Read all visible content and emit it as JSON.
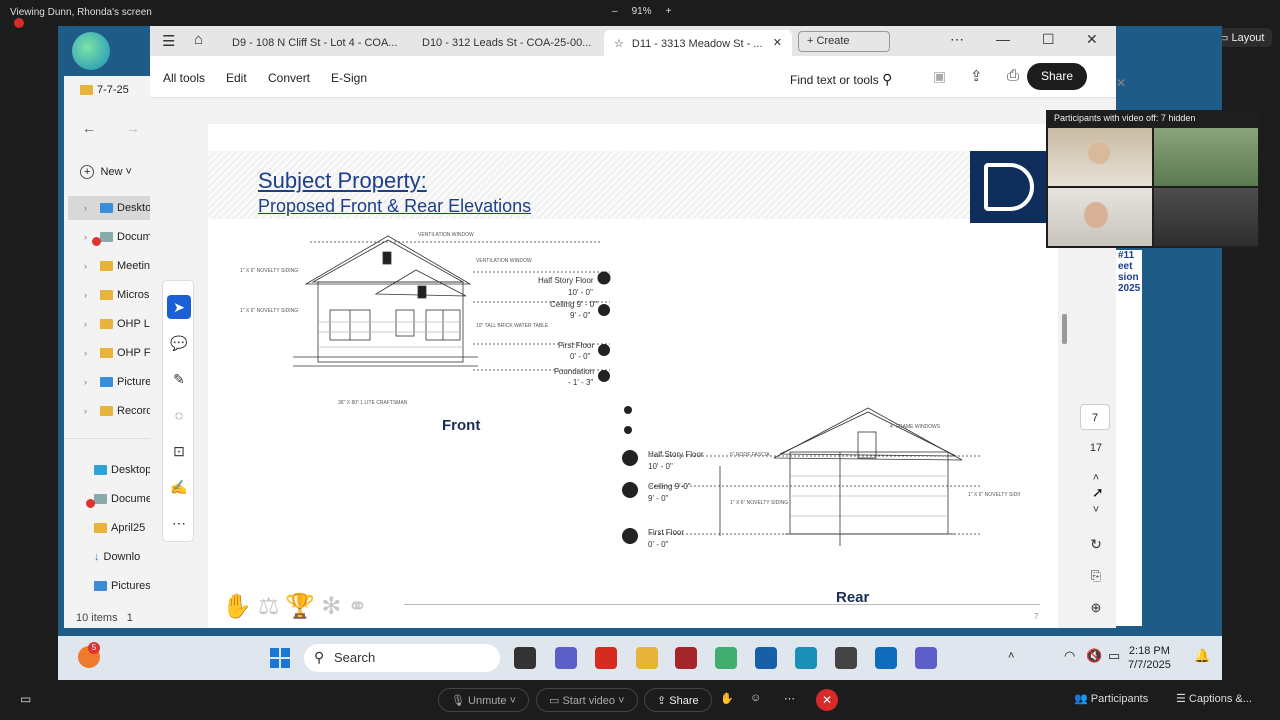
{
  "zoom": {
    "viewing_label": "Viewing Dunn, Rhonda's screen",
    "zoom_minus": "–",
    "zoom_level": "91%",
    "zoom_plus": "+",
    "layout_label": "Layout",
    "participants_overlay_title": "Participants with video off: 7 hidden",
    "bottom": {
      "unmute": "Unmute",
      "start_video": "Start video",
      "share": "Share",
      "participants": "Participants",
      "captions": "Captions &..."
    }
  },
  "explorer": {
    "title": "7-7-25",
    "new_label": "New",
    "items": [
      "Deskto",
      "Docum",
      "Meetin",
      "Micros",
      "OHP L",
      "OHP F",
      "Picture",
      "Record"
    ],
    "quick": [
      "Desktop",
      "Docume",
      "April25",
      "Downlo",
      "Pictures"
    ],
    "status": "10 items",
    "status_sel": "1"
  },
  "browser": {
    "tabs": [
      "D9 - 108 N Cliff St - Lot 4 - COA...",
      "D10 - 312 Leads St - COA-25-00...",
      "D11 - 3313 Meadow St - ..."
    ],
    "create_label": "Create",
    "toolbar": {
      "all_tools": "All tools",
      "edit": "Edit",
      "convert": "Convert",
      "esign": "E-Sign",
      "find": "Find text or tools",
      "share": "Share"
    }
  },
  "slide": {
    "title": "Subject Property:",
    "subtitle": "Proposed Front & Rear Elevations",
    "front_caption": "Front",
    "rear_caption": "Rear",
    "page_footer": "7",
    "side_text": [
      "#11",
      "eet",
      "sion",
      "2025"
    ],
    "front_levels": [
      {
        "name": "Half Story Floor",
        "value": "10' - 0\""
      },
      {
        "name": "Ceiling 9' - 0\"",
        "value": "9' - 0\""
      },
      {
        "name": "First Floor",
        "value": "0' - 0\""
      },
      {
        "name": "Foundation",
        "value": "- 1' - 3\""
      }
    ],
    "rear_levels": [
      {
        "name": "Half Story Floor",
        "value": "10' - 0\""
      },
      {
        "name": "Ceiling 9'-0\"",
        "value": "9' - 0\""
      },
      {
        "name": "First Floor",
        "value": "0' - 0\""
      }
    ]
  },
  "rail": {
    "current_page": "7",
    "total_pages": "17"
  },
  "taskbar": {
    "search_label": "Search",
    "notification_count": "5",
    "time": "2:18 PM",
    "date": "7/7/2025"
  }
}
